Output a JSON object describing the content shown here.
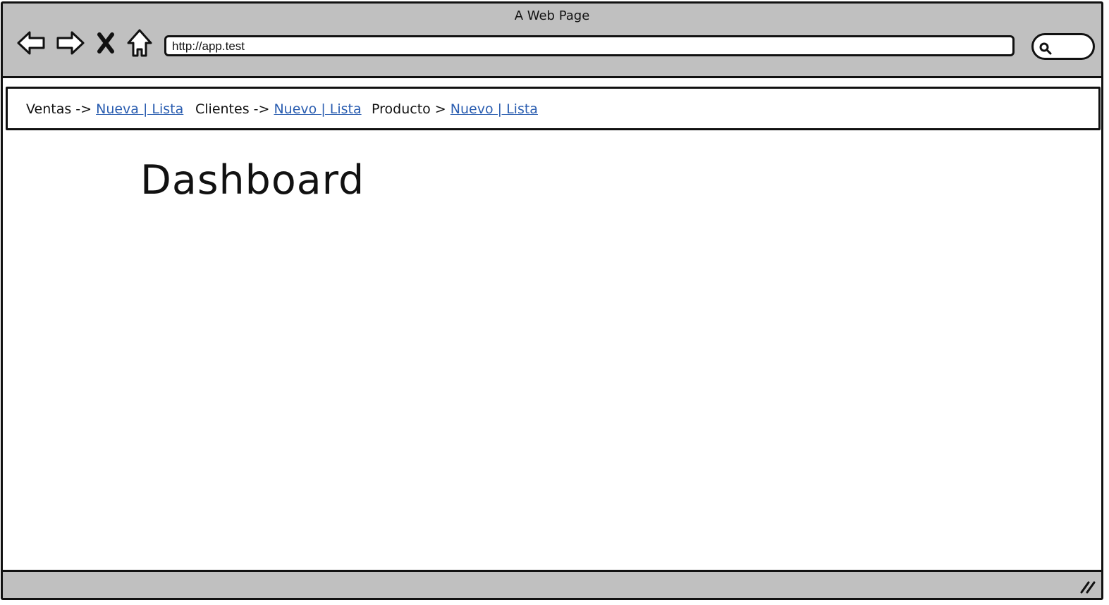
{
  "window": {
    "title": "A Web Page"
  },
  "toolbar": {
    "back_icon": "back-arrow-icon",
    "forward_icon": "forward-arrow-icon",
    "stop_icon": "close-x-icon",
    "home_icon": "home-icon",
    "url": "http://app.test",
    "search_icon": "search-icon"
  },
  "menu": {
    "groups": [
      {
        "label": "Ventas ->",
        "link": "Nueva | Lista"
      },
      {
        "label": "Clientes ->",
        "link": "Nuevo | Lista"
      },
      {
        "label": "Producto >",
        "link": "Nuevo | Lista"
      }
    ]
  },
  "main": {
    "title": "Dashboard"
  },
  "colors": {
    "chrome": "#c0c0c0",
    "link": "#2a5db0",
    "border": "#111111"
  }
}
